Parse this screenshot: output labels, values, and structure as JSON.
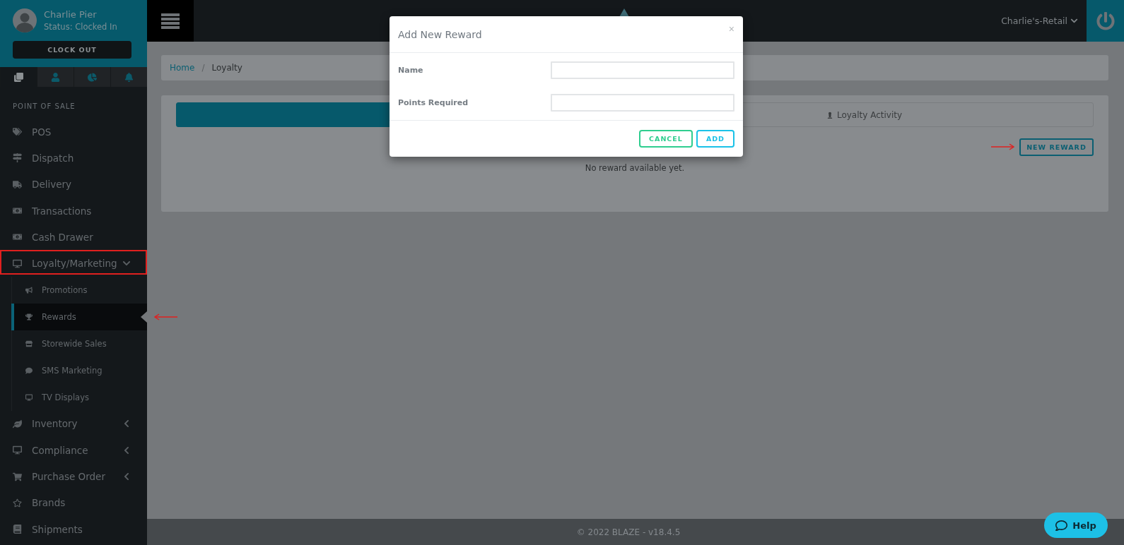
{
  "user": {
    "name": "Charlie Pier",
    "status": "Status: Clocked In",
    "button": "CLOCK OUT"
  },
  "sidebar_tabs": [
    {
      "selected": true
    },
    {
      "selected": false
    },
    {
      "selected": false
    },
    {
      "selected": false
    }
  ],
  "sidebar": {
    "section": "POINT OF SALE",
    "items": [
      {
        "label": "POS"
      },
      {
        "label": "Dispatch"
      },
      {
        "label": "Delivery"
      },
      {
        "label": "Transactions"
      },
      {
        "label": "Cash Drawer"
      },
      {
        "label": "Loyalty/Marketing",
        "expanded": true,
        "annotated": true,
        "children": [
          {
            "label": "Promotions",
            "selected": false
          },
          {
            "label": "Rewards",
            "selected": true
          },
          {
            "label": "Storewide Sales",
            "selected": false
          },
          {
            "label": "SMS Marketing",
            "selected": false
          },
          {
            "label": "TV Displays",
            "selected": false
          }
        ]
      },
      {
        "label": "Inventory",
        "expanded": false
      },
      {
        "label": "Compliance",
        "expanded": false
      },
      {
        "label": "Purchase Order",
        "expanded": false
      },
      {
        "label": "Brands"
      },
      {
        "label": "Shipments"
      }
    ]
  },
  "topbar": {
    "store": "Charlie's-Retail"
  },
  "breadcrumb": [
    "Home",
    "Loyalty"
  ],
  "breadcrumb_separator": "/",
  "tabs": [
    {
      "selected": true
    },
    {
      "label": "Loyalty Activity",
      "selected": false
    }
  ],
  "new_reward_button": "NEW REWARD",
  "empty_message": "No reward available yet.",
  "modal": {
    "title": "Add New Reward",
    "close": "×",
    "fields": [
      {
        "label": "Name"
      },
      {
        "label": "Points Required"
      }
    ],
    "buttons": [
      {
        "kind": "cancel",
        "label": "CANCEL"
      },
      {
        "kind": "add",
        "label": "ADD"
      }
    ]
  },
  "footer": "© 2022 BLAZE - v18.4.5",
  "help_button": "Help"
}
